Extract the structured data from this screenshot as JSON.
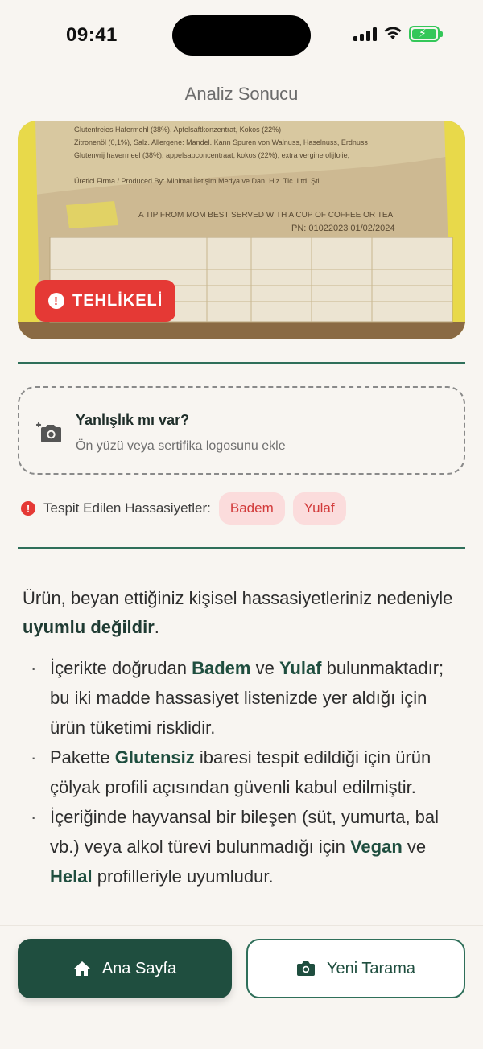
{
  "status_bar": {
    "time": "09:41"
  },
  "header": {
    "title": "Analiz Sonucu"
  },
  "product": {
    "badge_label": "TEHLİKELİ",
    "badge_color": "#e53935",
    "package_lines": [
      "Glutenfreies Hafermehl (38%), Apfelsaftkonzentrat, Kokos (22%)",
      "Zitronenöl (0,1%), Salz. Allergene: Mandel. Kann Spuren von Walnuss, Haselnuss, Erdnuss",
      "Glutenvrij havermeel (38%), appelsapconcentraat, kokos (22%), extra vergine olijfolie,",
      "Üretici Firma / Produced By: Minimal İletişim Medya ve Dan. Hiz. Tic. Ltd. Şti.",
      "A TIP FROM MOM  BEST SERVED WITH A CUP OF COFFEE OR TEA",
      "PN: 01022023  01/02/2024"
    ]
  },
  "report": {
    "title": "Yanlışlık mı var?",
    "subtitle": "Ön yüzü veya sertifika logosunu ekle"
  },
  "sensitivities": {
    "label": "Tespit Edilen Hassasiyetler:",
    "chips": [
      "Badem",
      "Yulaf"
    ]
  },
  "description": {
    "prefix": "Ürün, beyan ettiğiniz kişisel hassasiyetleriniz nedeniyle ",
    "emphasis": "uyumlu değildir",
    "suffix": "."
  },
  "bullets": [
    {
      "p1": "İçerikte doğrudan ",
      "b1": "Badem",
      "p2": " ve ",
      "b2": "Yulaf",
      "p3": " bulunmaktadır; bu iki madde hassasiyet listenizde yer aldığı için ürün tüketimi risklidir."
    },
    {
      "p1": "Pakette ",
      "b1": "Glutensiz",
      "p2": " ibaresi tespit edildiği için ürün çölyak profili açısından güvenli kabul edilmiştir.",
      "b2": "",
      "p3": ""
    },
    {
      "p1": "İçeriğinde hayvansal bir bileşen (süt, yumurta, bal vb.) veya alkol türevi bulunmadığı için ",
      "b1": "Vegan",
      "p2": " ve ",
      "b2": "Helal",
      "p3": " profilleriyle uyumludur."
    }
  ],
  "actions": {
    "home_label": "Ana Sayfa",
    "scan_label": "Yeni Tarama"
  },
  "colors": {
    "primary": "#1f4e3f",
    "danger": "#e53935",
    "chip_bg": "#fbdcdc",
    "background": "#f8f5f1"
  }
}
